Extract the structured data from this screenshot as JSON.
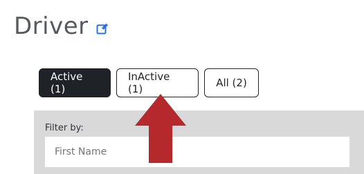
{
  "page": {
    "title": "Driver",
    "edit_icon": "edit-icon"
  },
  "tabs": [
    {
      "label": "Active (1)",
      "active": true
    },
    {
      "label": "InActive (1)",
      "active": false
    },
    {
      "label": "All (2)",
      "active": false
    }
  ],
  "filter": {
    "label": "Filter by:",
    "placeholder": "First Name",
    "value": ""
  },
  "annotation": {
    "icon": "up-arrow-annotation",
    "color": "#b5282b"
  },
  "colors": {
    "accent": "#1f2328",
    "link_icon": "#2a6fdb",
    "panel": "#d9d9d9"
  }
}
